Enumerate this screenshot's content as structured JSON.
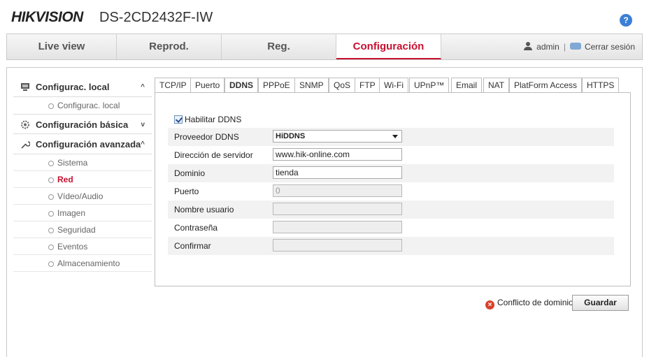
{
  "header": {
    "brand": "HIKVISION",
    "model": "DS-2CD2432F-IW",
    "help_glyph": "?"
  },
  "nav": {
    "items": [
      "Live view",
      "Reprod.",
      "Reg.",
      "Configuración"
    ],
    "active_index": 3,
    "user": "admin",
    "separator": "|",
    "logout": "Cerrar sesión"
  },
  "sidebar": {
    "local": {
      "label": "Configurac. local",
      "chevron": "^",
      "sub": "Configurac. local"
    },
    "basic": {
      "label": "Configuración básica",
      "chevron": "v"
    },
    "advanced": {
      "label": "Configuración avanzada",
      "chevron": "^",
      "items": [
        "Sistema",
        "Red",
        "Vídeo/Audio",
        "Imagen",
        "Seguridad",
        "Eventos",
        "Almacenamiento"
      ],
      "active_index": 1
    }
  },
  "tabs": {
    "items": [
      "TCP/IP",
      "Puerto",
      "DDNS",
      "PPPoE",
      "SNMP",
      "QoS",
      "FTP",
      "Wi-Fi",
      "UPnP™",
      "Email",
      "NAT",
      "PlatForm Access",
      "HTTPS"
    ],
    "active_index": 2
  },
  "form": {
    "enable_label": "Habilitar DDNS",
    "enable_checked": true,
    "provider_label": "Proveedor DDNS",
    "provider_value": "HiDDNS",
    "server_label": "Dirección de servidor",
    "server_value": "www.hik-online.com",
    "domain_label": "Dominio",
    "domain_value": "tienda",
    "port_label": "Puerto",
    "port_value": "0",
    "username_label": "Nombre usuario",
    "username_value": "",
    "password_label": "Contraseña",
    "password_value": "",
    "confirm_label": "Confirmar",
    "confirm_value": ""
  },
  "status": {
    "error_glyph": "×",
    "message": "Conflicto de dominio",
    "save": "Guardar"
  },
  "colors": {
    "accent": "#c8102e",
    "help": "#3b7fd6",
    "error": "#d9412b"
  }
}
